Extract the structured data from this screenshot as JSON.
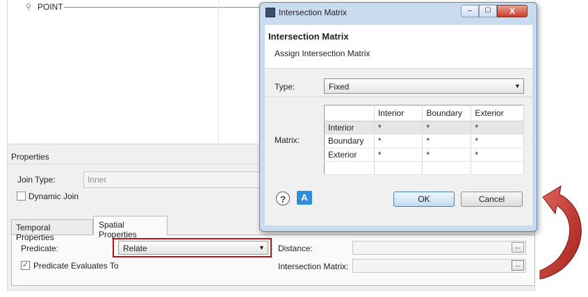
{
  "tree": {
    "point_label": "POINT"
  },
  "properties": {
    "section_title": "Properties",
    "join_type_label": "Join Type:",
    "join_type_value": "Inner",
    "dynamic_join_label": "Dynamic Join",
    "tabs": [
      {
        "label": "Temporal Properties"
      },
      {
        "label": "Spatial Properties"
      }
    ],
    "predicate_label": "Predicate:",
    "predicate_value": "Relate",
    "predicate_evaluates_label": "Predicate Evaluates To",
    "distance_label": "Distance:",
    "intersection_matrix_label": "Intersection Matrix:",
    "browse_label": "..."
  },
  "dialog": {
    "title": "Intersection Matrix",
    "heading": "Intersection Matrix",
    "subheading": "Assign Intersection Matrix",
    "type_label": "Type:",
    "type_value": "Fixed",
    "matrix_label": "Matrix:",
    "columns": [
      "",
      "Interior",
      "Boundary",
      "Exterior"
    ],
    "rows": [
      {
        "name": "Interior",
        "cells": [
          "*",
          "*",
          "*"
        ]
      },
      {
        "name": "Boundary",
        "cells": [
          "*",
          "*",
          "*"
        ]
      },
      {
        "name": "Exterior",
        "cells": [
          "*",
          "*",
          "*"
        ]
      }
    ],
    "help_glyph": "?",
    "assist_glyph": "A",
    "ok_label": "OK",
    "cancel_label": "Cancel",
    "close_glyph": "X"
  },
  "colors": {
    "highlight": "#b50f17",
    "arrow": "#c0322b"
  }
}
